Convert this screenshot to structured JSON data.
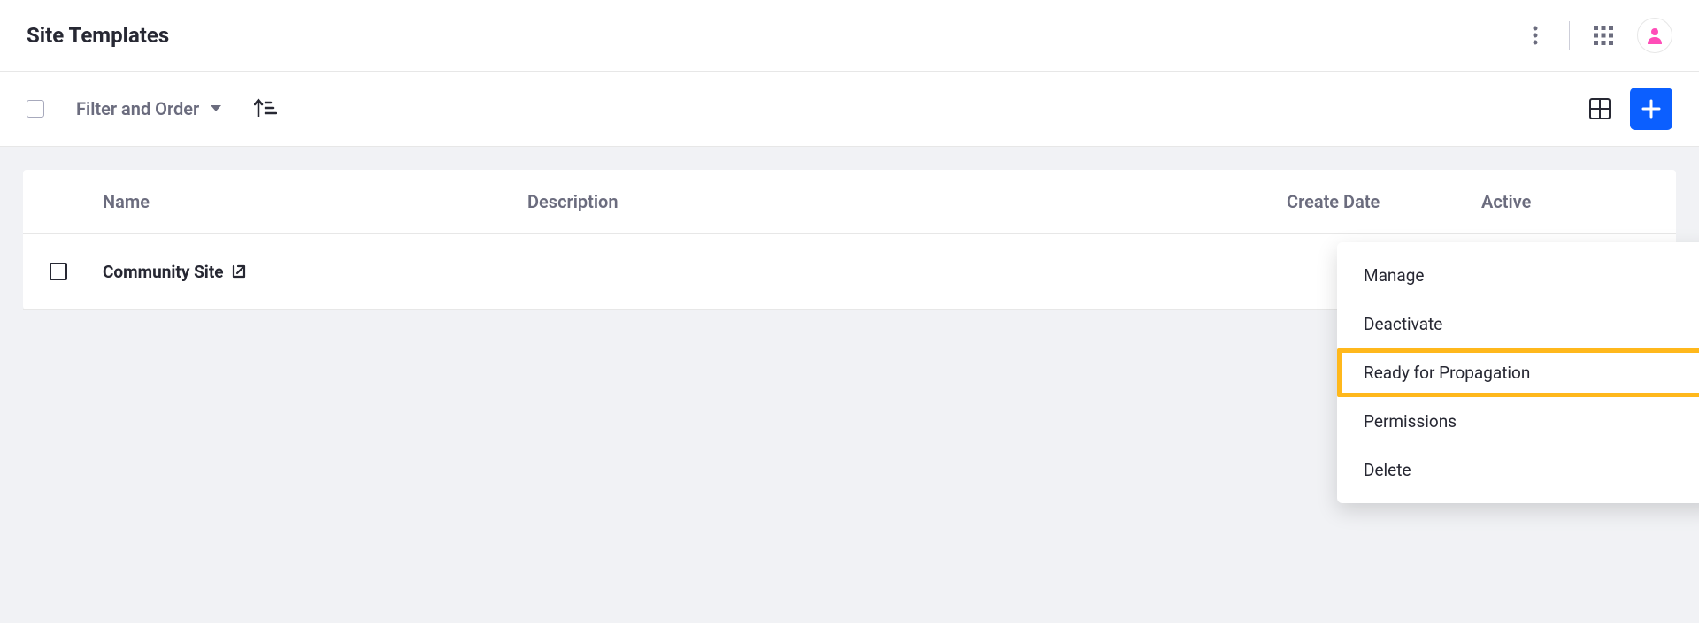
{
  "header": {
    "title": "Site Templates"
  },
  "toolbar": {
    "filter_label": "Filter and Order"
  },
  "table": {
    "columns": {
      "name": "Name",
      "description": "Description",
      "createDate": "Create Date",
      "active": "Active"
    },
    "rows": [
      {
        "name": "Community Site"
      }
    ]
  },
  "dropdown": {
    "items": {
      "manage": "Manage",
      "deactivate": "Deactivate",
      "ready_propagation": "Ready for Propagation",
      "permissions": "Permissions",
      "delete": "Delete"
    }
  }
}
